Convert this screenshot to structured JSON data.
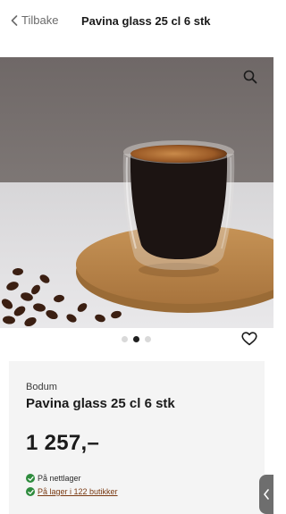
{
  "header": {
    "back_label": "Tilbake",
    "title": "Pavina glass 25 cl 6 stk"
  },
  "gallery": {
    "image_alt": "Pavina glass med kaffe på korkunderlag",
    "dots": 3,
    "active_dot": 2
  },
  "product": {
    "brand": "Bodum",
    "name": "Pavina glass 25 cl 6 stk",
    "price": "1 257,–",
    "stock_online": "På nettlager",
    "stock_stores": "På lager i 122 butikker"
  },
  "colors": {
    "accent_link": "#7a3a12",
    "in_stock": "#2e8b3d"
  }
}
